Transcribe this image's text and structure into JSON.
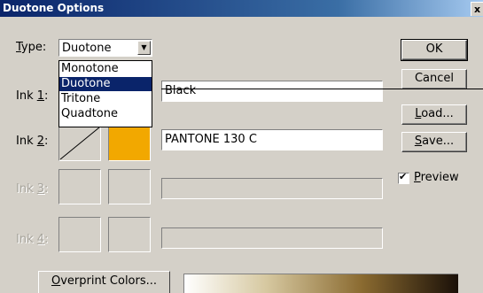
{
  "window": {
    "title": "Duotone Options",
    "close_glyph": "x"
  },
  "type_field": {
    "label_pre": "",
    "label_u": "T",
    "label_post": "ype:",
    "selected": "Duotone",
    "options": [
      "Monotone",
      "Duotone",
      "Tritone",
      "Quadtone"
    ]
  },
  "inks": [
    {
      "label_pre": "Ink ",
      "label_u": "1",
      "label_post": ":",
      "name": "Black",
      "enabled": true
    },
    {
      "label_pre": "Ink ",
      "label_u": "2",
      "label_post": ":",
      "name": "PANTONE 130 C",
      "enabled": true,
      "color": "#f2a800"
    },
    {
      "label_pre": "Ink ",
      "label_u": "3",
      "label_post": ":",
      "name": "",
      "enabled": false
    },
    {
      "label_pre": "Ink ",
      "label_u": "4",
      "label_post": ":",
      "name": "",
      "enabled": false
    }
  ],
  "buttons": {
    "ok": {
      "pre": "",
      "u": "",
      "post": "OK"
    },
    "cancel": {
      "pre": "",
      "u": "",
      "post": "Cancel"
    },
    "load": {
      "pre": "",
      "u": "L",
      "post": "oad..."
    },
    "save": {
      "pre": "",
      "u": "S",
      "post": "ave..."
    },
    "overprint": {
      "pre": "",
      "u": "O",
      "post": "verprint Colors..."
    }
  },
  "preview": {
    "u": "P",
    "post": "review",
    "checked": true,
    "check_glyph": "✔"
  },
  "icons": {
    "dropdown_arrow": "▼"
  }
}
